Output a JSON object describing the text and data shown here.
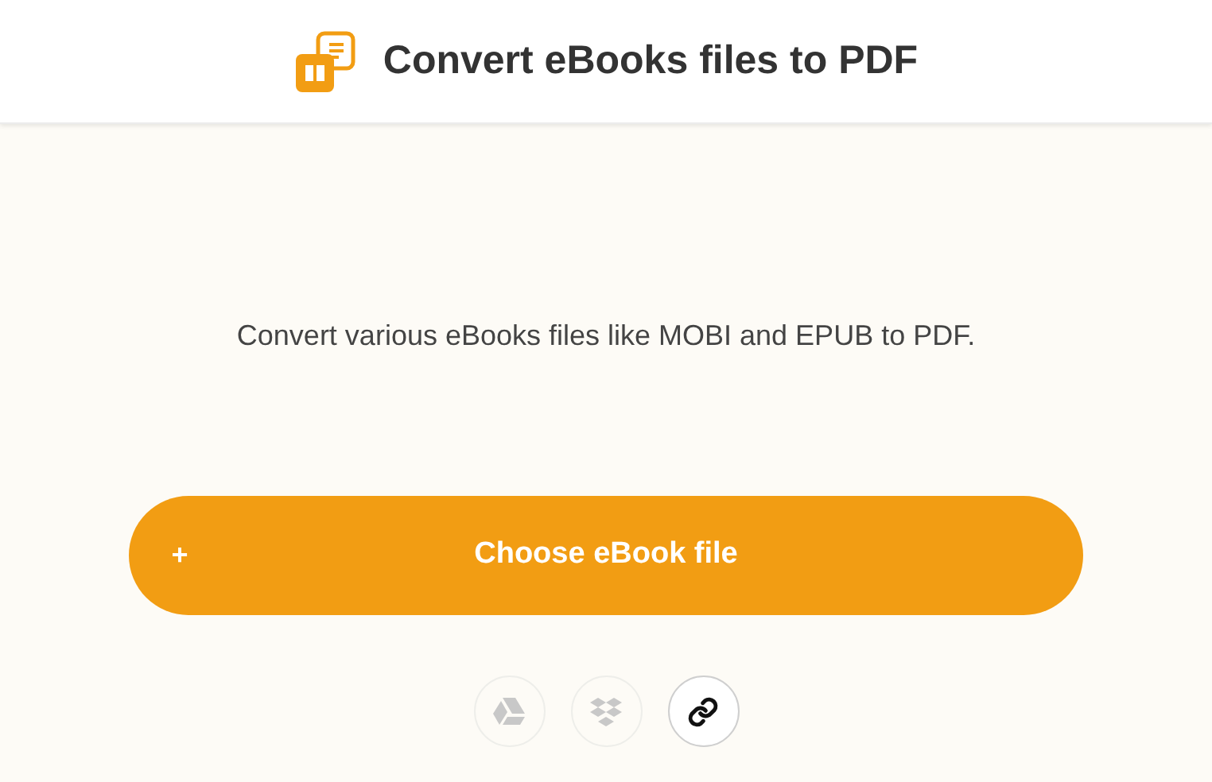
{
  "header": {
    "title": "Convert eBooks files to PDF"
  },
  "description": "Convert various eBooks files like MOBI and EPUB to PDF.",
  "upload_button": {
    "icon": "+",
    "label": "Choose eBook file"
  },
  "sources": [
    {
      "kind": "drive",
      "disabled": true
    },
    {
      "kind": "dropbox",
      "disabled": true
    },
    {
      "kind": "link",
      "disabled": false
    }
  ]
}
